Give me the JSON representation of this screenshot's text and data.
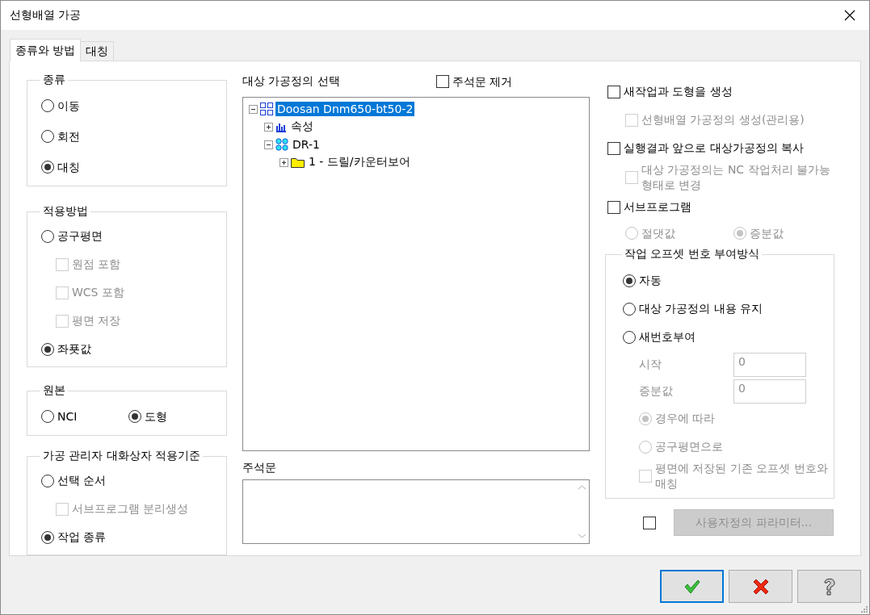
{
  "window": {
    "title": "선형배열 가공"
  },
  "tabs": [
    {
      "label": "종류와 방법",
      "selected": true
    },
    {
      "label": "대칭",
      "selected": false
    }
  ],
  "left_groups": [
    {
      "title": "종류",
      "items": [
        {
          "kind": "radio",
          "label": "이동",
          "selected": false
        },
        {
          "kind": "radio",
          "label": "회전",
          "selected": false
        },
        {
          "kind": "radio",
          "label": "대칭",
          "selected": true
        }
      ]
    },
    {
      "title": "적용방법",
      "items": [
        {
          "kind": "radio",
          "label": "공구평면",
          "selected": false,
          "children": [
            {
              "kind": "checkbox",
              "label": "원점 포함",
              "checked": false,
              "disabled": true
            },
            {
              "kind": "checkbox",
              "label": "WCS 포함",
              "checked": false,
              "disabled": true
            },
            {
              "kind": "checkbox",
              "label": "평면 저장",
              "checked": false,
              "disabled": true
            }
          ]
        },
        {
          "kind": "radio",
          "label": "좌푯값",
          "selected": true
        }
      ]
    },
    {
      "title": "원본",
      "items": [
        {
          "kind": "radio",
          "label": "NCI",
          "selected": false
        },
        {
          "kind": "radio",
          "label": "도형",
          "selected": true
        }
      ]
    },
    {
      "title": "가공 관리자 대화상자 적용기준",
      "items": [
        {
          "kind": "radio",
          "label": "선택 순서",
          "selected": false,
          "children": [
            {
              "kind": "checkbox",
              "label": "서브프로그램 분리생성",
              "checked": false,
              "disabled": true
            }
          ]
        },
        {
          "kind": "radio",
          "label": "작업 종류",
          "selected": true
        }
      ]
    }
  ],
  "operation_select": {
    "label": "대상 가공정의 선택",
    "remove_comments": {
      "label": "주석문 제거",
      "checked": false
    },
    "tree": [
      {
        "label": "Doosan Dnm650-bt50-2",
        "kind": "machine",
        "expanded": true,
        "selected": true,
        "children": [
          {
            "label": "속성",
            "kind": "properties",
            "expanded": false,
            "selected": false
          },
          {
            "label": "DR-1",
            "kind": "operations",
            "expanded": true,
            "selected": false,
            "children": [
              {
                "label": "1 - 드릴/카운터보어",
                "kind": "folder",
                "expanded": false,
                "selected": false
              }
            ]
          }
        ]
      }
    ]
  },
  "comment": {
    "label": "주석문"
  },
  "right_options": [
    {
      "kind": "checkbox",
      "label": "새작업과 도형을 생성",
      "checked": false,
      "children": [
        {
          "kind": "checkbox",
          "label": "선형배열 가공정의 생성(관리용)",
          "checked": false,
          "disabled": true
        }
      ]
    },
    {
      "kind": "checkbox",
      "label": "실행결과 앞으로 대상가공정의 복사",
      "checked": false,
      "children": [
        {
          "kind": "checkbox",
          "label": "대상 가공정의는 NC 작업처리 불가능 형태로 변경",
          "checked": false,
          "disabled": true
        }
      ]
    },
    {
      "kind": "checkbox",
      "label": "서브프로그램",
      "checked": false,
      "children": [
        {
          "kind": "radio",
          "label": "절댓값",
          "selected": false,
          "disabled": true
        },
        {
          "kind": "radio",
          "label": "증분값",
          "selected": true,
          "disabled": true
        }
      ]
    }
  ],
  "offset_group": {
    "title": "작업 오프셋 번호 부여방식",
    "items": [
      {
        "kind": "radio",
        "label": "자동",
        "selected": true
      },
      {
        "kind": "radio",
        "label": "대상 가공정의 내용 유지",
        "selected": false
      },
      {
        "kind": "radio",
        "label": "새번호부여",
        "selected": false,
        "children": [
          {
            "kind": "field",
            "label": "시작",
            "value": "0",
            "disabled": true
          },
          {
            "kind": "field",
            "label": "증분값",
            "value": "0",
            "disabled": true
          },
          {
            "kind": "radio",
            "label": "경우에 따라",
            "selected": true,
            "disabled": true
          },
          {
            "kind": "radio",
            "label": "공구평면으로",
            "selected": false,
            "disabled": true
          },
          {
            "kind": "checkbox",
            "label": "평면에 저장된 기존 오프셋 번호와 매칭",
            "checked": false,
            "disabled": true
          }
        ]
      }
    ]
  },
  "custom_parameters": {
    "checked": false,
    "button": {
      "label": "사용자정의 파라미터...",
      "disabled": true
    }
  },
  "buttons": [
    {
      "kind": "ok",
      "focused": true
    },
    {
      "kind": "cancel",
      "focused": false
    },
    {
      "kind": "help",
      "focused": false
    }
  ]
}
